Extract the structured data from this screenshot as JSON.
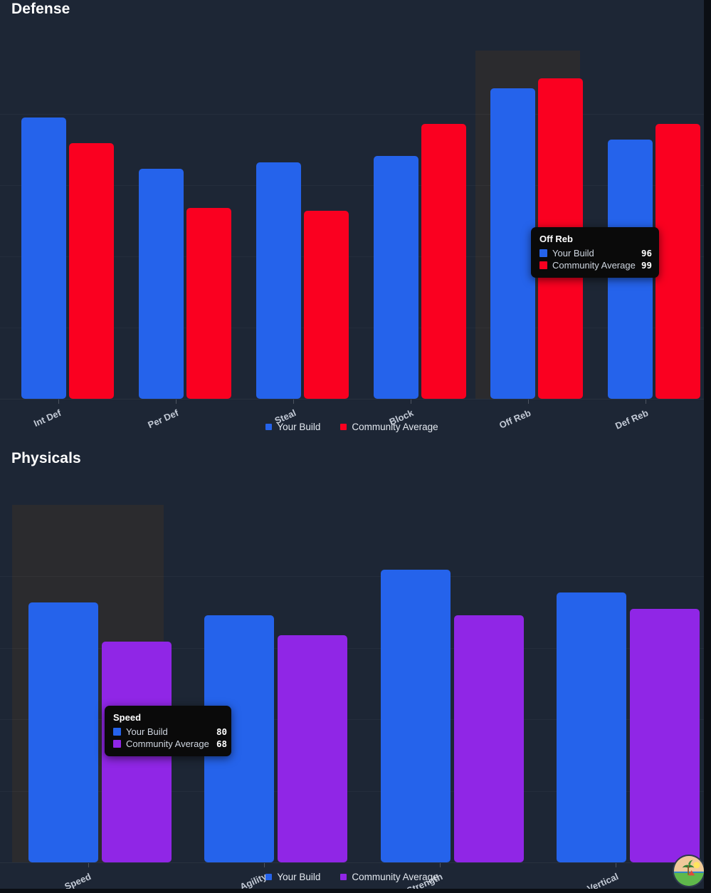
{
  "page": {
    "background": "#1d2635",
    "outer_background": "#0b0e14"
  },
  "colors": {
    "your_build": "#2563eb",
    "community_average_defense": "#fa0020",
    "community_average_physicals": "#9026e6",
    "hover_band": "#2b2b2e",
    "tooltip_background": "#0a0a0a",
    "title_text": "#ffffff",
    "axis_label_text": "#c3cad6"
  },
  "sections": [
    {
      "id": "defense",
      "title": "Defense",
      "legend": [
        {
          "label": "Your Build",
          "color": "#2563eb"
        },
        {
          "label": "Community Average",
          "color": "#fa0020"
        }
      ],
      "tooltip": {
        "title": "Off Reb",
        "rows": [
          {
            "label": "Your Build",
            "value": "96",
            "color": "#2563eb"
          },
          {
            "label": "Community Average",
            "value": "99",
            "color": "#fa0020"
          }
        ]
      },
      "hovered_category": "Off Reb"
    },
    {
      "id": "physicals",
      "title": "Physicals",
      "legend": [
        {
          "label": "Your Build",
          "color": "#2563eb"
        },
        {
          "label": "Community Average",
          "color": "#9026e6"
        }
      ],
      "tooltip": {
        "title": "Speed",
        "rows": [
          {
            "label": "Your Build",
            "value": "80",
            "color": "#2563eb"
          },
          {
            "label": "Community Average",
            "value": "68",
            "color": "#9026e6"
          }
        ]
      },
      "hovered_category": "Speed"
    }
  ],
  "avatar": {
    "name": "island-avatar",
    "description": "beach island with palm tree and sun"
  },
  "chart_data": [
    {
      "type": "bar",
      "title": "Defense",
      "xlabel": "",
      "ylabel": "",
      "ylim": [
        0,
        110
      ],
      "grid": true,
      "legend_position": "bottom",
      "categories": [
        "Int Def",
        "Per Def",
        "Steal",
        "Block",
        "Off Reb",
        "Def Reb"
      ],
      "series": [
        {
          "name": "Your Build",
          "color": "#2563eb",
          "values": [
            87,
            71,
            73,
            75,
            96,
            80
          ]
        },
        {
          "name": "Community Average",
          "color": "#fa0020",
          "values": [
            79,
            59,
            58,
            85,
            99,
            85
          ]
        }
      ],
      "annotations": [
        {
          "type": "tooltip",
          "category": "Off Reb",
          "values": {
            "Your Build": 96,
            "Community Average": 99
          }
        }
      ]
    },
    {
      "type": "bar",
      "title": "Physicals",
      "xlabel": "",
      "ylabel": "",
      "ylim": [
        0,
        110
      ],
      "grid": true,
      "legend_position": "bottom",
      "categories": [
        "Speed",
        "Agility",
        "Strength",
        "Vertical"
      ],
      "series": [
        {
          "name": "Your Build",
          "color": "#2563eb",
          "values": [
            80,
            76,
            90,
            83
          ]
        },
        {
          "name": "Community Average",
          "color": "#9026e6",
          "values": [
            68,
            70,
            76,
            78
          ]
        }
      ],
      "annotations": [
        {
          "type": "tooltip",
          "category": "Speed",
          "values": {
            "Your Build": 80,
            "Community Average": 68
          }
        }
      ]
    }
  ]
}
